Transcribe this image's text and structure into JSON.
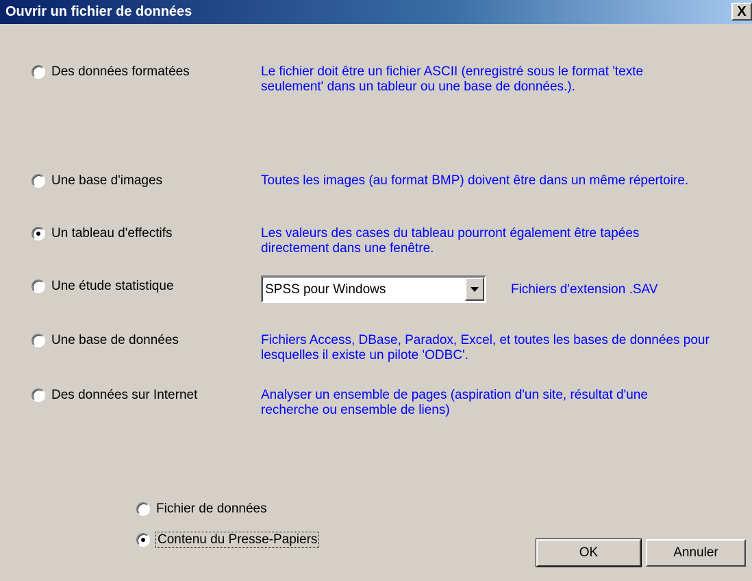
{
  "window": {
    "title": "Ouvrir un fichier de données",
    "close_label": "X"
  },
  "options": [
    {
      "label": "Des données formatées",
      "selected": false,
      "description": "Le fichier doit être un fichier ASCII (enregistré sous le format 'texte seulement' dans un tableur ou une base de données.)."
    },
    {
      "label": "Une base d'images",
      "selected": false,
      "description": "Toutes les images (au format BMP) doivent être dans un même répertoire."
    },
    {
      "label": "Un tableau d'effectifs",
      "selected": true,
      "description": "Les valeurs des cases du tableau pourront également être tapées directement dans une fenêtre."
    },
    {
      "label": "Une étude statistique",
      "selected": false,
      "description": "Fichiers d'extension .SAV"
    },
    {
      "label": "Une base de données",
      "selected": false,
      "description": "Fichiers Access, DBase, Paradox, Excel, et toutes les bases de données pour lesquelles il existe un pilote 'ODBC'."
    },
    {
      "label": "Des données sur Internet",
      "selected": false,
      "description": "Analyser un ensemble de pages (aspiration d'un site, résultat d'une recherche ou ensemble de liens)"
    }
  ],
  "stat_format": {
    "selected": "SPSS pour Windows"
  },
  "source": [
    {
      "label": "Fichier de données",
      "selected": false
    },
    {
      "label": "Contenu du Presse-Papiers",
      "selected": true
    }
  ],
  "buttons": {
    "ok": "OK",
    "cancel": "Annuler"
  },
  "colors": {
    "face": "#d4d0c8",
    "title_start": "#0a246a",
    "title_end": "#a6caf0",
    "description_text": "#0000ff"
  }
}
